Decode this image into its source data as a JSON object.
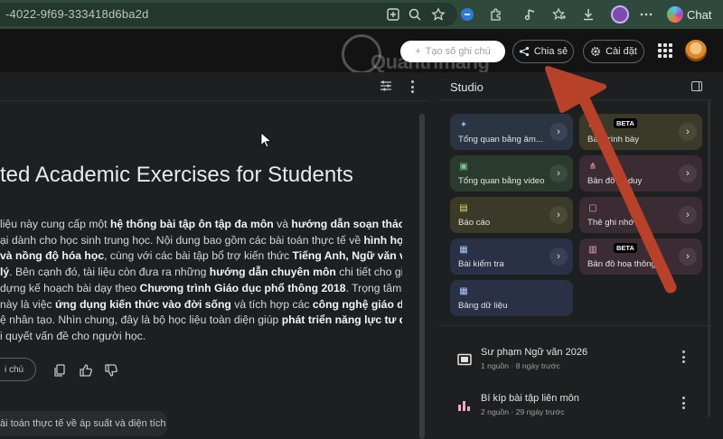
{
  "browser": {
    "url": "-4022-9f69-333418d6ba2d",
    "chat_label": "Chat"
  },
  "header": {
    "watermark": "Quantrimang",
    "add_note_label": "Tạo số ghi chú",
    "share_label": "Chia sẻ",
    "settings_label": "Cài đặt"
  },
  "chat": {
    "title": "ted Academic Exercises for Students",
    "summary_lines": [
      [
        {
          "t": "liệu này cung cấp một "
        },
        {
          "t": "hệ thống bài tập ôn tập đa môn",
          "b": true
        },
        {
          "t": " và "
        },
        {
          "t": "hướng dẫn soạn thảo",
          "b": true
        }
      ],
      [
        {
          "t": "ại dành cho học sinh trung học. Nội dung bao gồm các bài toán thực tế về "
        },
        {
          "t": "hình học,",
          "b": true
        }
      ],
      [
        {
          "t": "và nồng độ hóa học",
          "b": true
        },
        {
          "t": ", cùng với các bài tập bổ trợ kiến thức "
        },
        {
          "t": "Tiếng Anh, Ngữ văn và",
          "b": true
        }
      ],
      [
        {
          "t": "lý",
          "b": true
        },
        {
          "t": ". Bên cạnh đó, tài liệu còn đưa ra những "
        },
        {
          "t": "hướng dẫn chuyên môn",
          "b": true
        },
        {
          "t": " chi tiết cho giáo"
        }
      ],
      [
        {
          "t": " dựng kế hoạch bài dạy theo "
        },
        {
          "t": "Chương trình Giáo dục phổ thông 2018",
          "b": true
        },
        {
          "t": ". Trọng tâm"
        }
      ],
      [
        {
          "t": " này là việc "
        },
        {
          "t": "ứng dụng kiến thức vào đời sống",
          "b": true
        },
        {
          "t": " và tích hợp các "
        },
        {
          "t": "công nghệ giáo dục",
          "b": true
        }
      ],
      [
        {
          "t": "ệ nhân tạo. Nhìn chung, đây là bộ học liệu toàn diện giúp "
        },
        {
          "t": "phát triển năng lực tư duy",
          "b": true
        }
      ],
      [
        {
          "t": "i quyết vấn đề cho người học."
        }
      ]
    ],
    "save_note_label": "i chú",
    "suggestion": "ài toán thực tế về áp suất và diện tích"
  },
  "studio": {
    "title": "Studio",
    "tools": [
      {
        "label": "Tổng quan bằng âm...",
        "icon": "audio-overview-icon",
        "glyph": "✦",
        "color": "blue"
      },
      {
        "label": "Bản trình bày",
        "icon": "slides-icon",
        "glyph": "▭",
        "color": "olive",
        "badge": "BETA"
      },
      {
        "label": "Tổng quan bằng video",
        "icon": "video-overview-icon",
        "glyph": "▣",
        "color": "green"
      },
      {
        "label": "Bản đồ tư duy",
        "icon": "mind-map-icon",
        "glyph": "⋔",
        "color": "pink"
      },
      {
        "label": "Báo cáo",
        "icon": "report-icon",
        "glyph": "▤",
        "color": "olive"
      },
      {
        "label": "Thẻ ghi nhớ",
        "icon": "flashcards-icon",
        "glyph": "▢",
        "color": "pink"
      },
      {
        "label": "Bài kiểm tra",
        "icon": "quiz-icon",
        "glyph": "▦",
        "color": "indigo"
      },
      {
        "label": "Bản đồ hoạ thông ...",
        "icon": "infographic-icon",
        "glyph": "▥",
        "color": "pink",
        "badge": "BETA"
      },
      {
        "label": "Bảng dữ liệu",
        "icon": "data-table-icon",
        "glyph": "▦",
        "color": "indigo"
      }
    ],
    "notes": [
      {
        "title": "Sư phạm Ngữ văn 2026",
        "meta": "1 nguồn · 8 ngày trước",
        "icon": "slides-note-icon"
      },
      {
        "title": "Bí kíp bài tập liên môn",
        "meta": "2 nguồn · 29 ngày trước",
        "icon": "infographic-note-icon"
      }
    ]
  },
  "colors": {
    "annotation_arrow": "#b8412a",
    "studio_blue": "#2a3443",
    "studio_green": "#2b3a2e",
    "studio_olive": "#3b3a28",
    "studio_pink": "#3b2c33"
  }
}
